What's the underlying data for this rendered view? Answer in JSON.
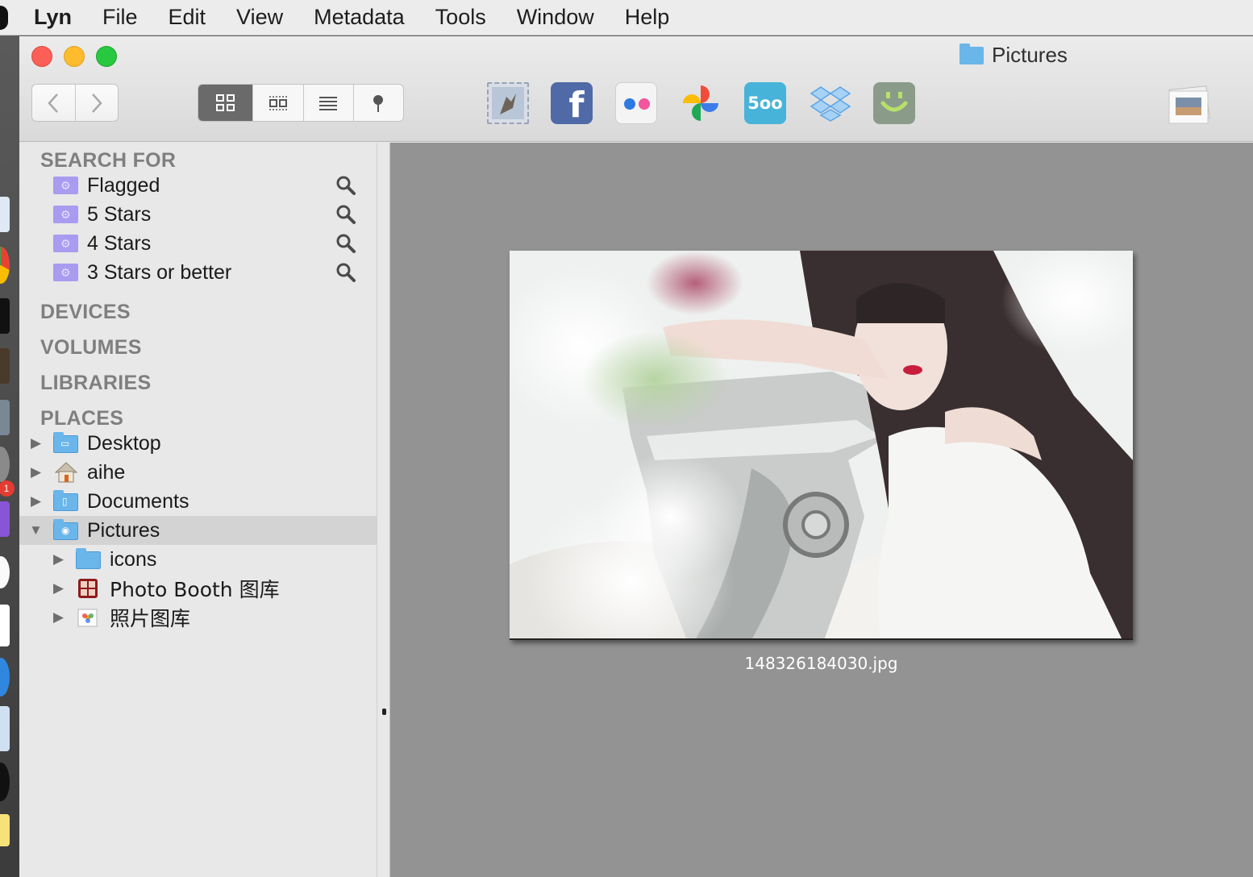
{
  "menubar": {
    "app": "Lyn",
    "items": [
      "File",
      "Edit",
      "View",
      "Metadata",
      "Tools",
      "Window",
      "Help"
    ]
  },
  "window": {
    "title": "Pictures",
    "title_icon": "folder-icon"
  },
  "toolbar": {
    "nav": [
      "back-icon",
      "forward-icon"
    ],
    "views": [
      "grid-view-icon",
      "filmstrip-view-icon",
      "list-view-icon",
      "map-view-icon"
    ],
    "active_view": "grid-view-icon",
    "share_services": [
      "mail-icon",
      "facebook-icon",
      "flickr-icon",
      "google-photos-icon",
      "500px-icon",
      "dropbox-icon",
      "smugmug-icon"
    ],
    "fivehundred_text": "5oo",
    "facebook_text": "f"
  },
  "sidebar": {
    "search_header": "SEARCH FOR",
    "searches": [
      "Flagged",
      "5 Stars",
      "4 Stars",
      "3 Stars or better"
    ],
    "devices_header": "DEVICES",
    "volumes_header": "VOLUMES",
    "libraries_header": "LIBRARIES",
    "places_header": "PLACES",
    "places": [
      {
        "label": "Desktop",
        "icon": "desktop-folder-icon",
        "expanded": false
      },
      {
        "label": "aihe",
        "icon": "home-icon",
        "expanded": false
      },
      {
        "label": "Documents",
        "icon": "documents-folder-icon",
        "expanded": false
      },
      {
        "label": "Pictures",
        "icon": "pictures-folder-icon",
        "expanded": true,
        "selected": true
      }
    ],
    "children": [
      {
        "label": "icons",
        "icon": "folder-icon"
      },
      {
        "label": "Photo Booth 图库",
        "icon": "photo-booth-icon"
      },
      {
        "label": "照片图库",
        "icon": "photos-library-icon"
      }
    ]
  },
  "content": {
    "photo_caption": "148326184030.jpg"
  },
  "dock": {
    "badge": "1"
  },
  "colors": {
    "content_bg": "#939393",
    "sidebar_bg": "#e8e8e8",
    "selection": "#d3d3d3",
    "smart_folder": "#a99bef",
    "folder_blue": "#6ab5ea"
  }
}
